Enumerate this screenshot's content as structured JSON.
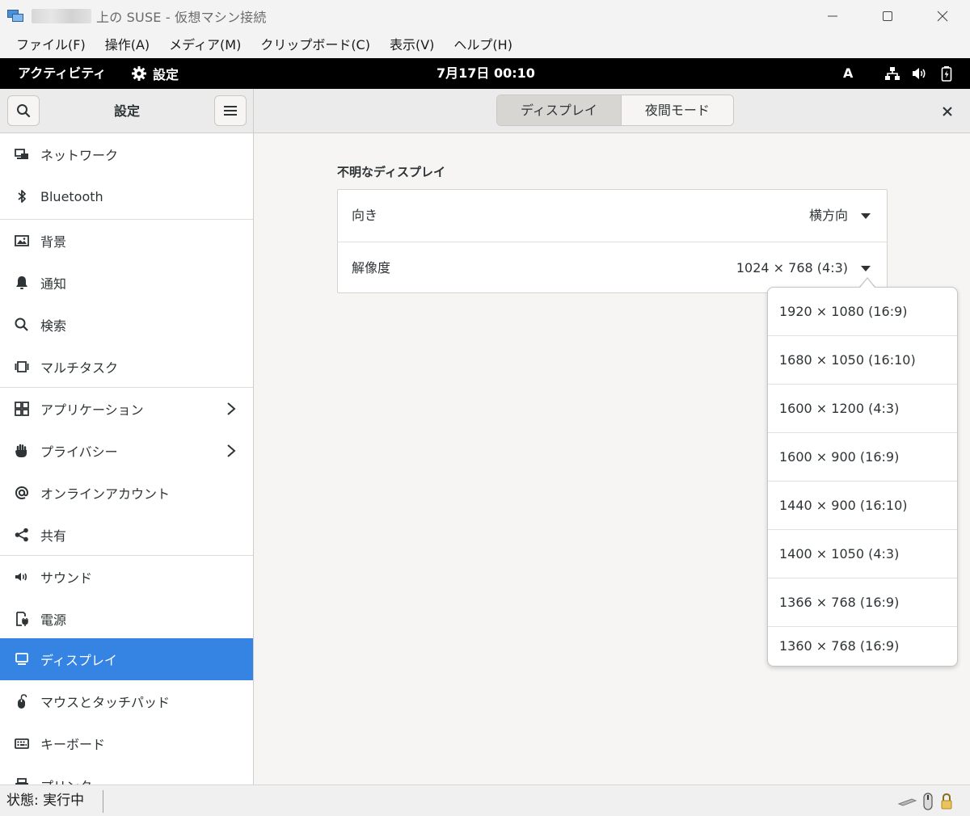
{
  "window": {
    "title": "上の SUSE  - 仮想マシン接続"
  },
  "menu": {
    "items": [
      "ファイル(F)",
      "操作(A)",
      "メディア(M)",
      "クリップボード(C)",
      "表示(V)",
      "ヘルプ(H)"
    ]
  },
  "topbar": {
    "activities": "アクティビティ",
    "app_name": "設定",
    "clock": "7月17日  00:10",
    "input_method": "A"
  },
  "header": {
    "sidebar_title": "設定",
    "tabs": [
      {
        "label": "ディスプレイ",
        "active": true
      },
      {
        "label": "夜間モード",
        "active": false
      }
    ]
  },
  "sidebar": {
    "items": [
      {
        "label": "ネットワーク",
        "icon": "network-icon",
        "chevron": false,
        "selected": false
      },
      {
        "label": "Bluetooth",
        "icon": "bluetooth-icon",
        "chevron": false,
        "selected": false
      },
      {
        "label": "背景",
        "icon": "background-icon",
        "chevron": false,
        "selected": false
      },
      {
        "label": "通知",
        "icon": "bell-icon",
        "chevron": false,
        "selected": false
      },
      {
        "label": "検索",
        "icon": "search-icon",
        "chevron": false,
        "selected": false
      },
      {
        "label": "マルチタスク",
        "icon": "multitasking-icon",
        "chevron": false,
        "selected": false
      },
      {
        "label": "アプリケーション",
        "icon": "apps-grid-icon",
        "chevron": true,
        "selected": false
      },
      {
        "label": "プライバシー",
        "icon": "hand-icon",
        "chevron": true,
        "selected": false
      },
      {
        "label": "オンラインアカウント",
        "icon": "at-sign-icon",
        "chevron": false,
        "selected": false
      },
      {
        "label": "共有",
        "icon": "share-icon",
        "chevron": false,
        "selected": false
      },
      {
        "label": "サウンド",
        "icon": "speaker-icon",
        "chevron": false,
        "selected": false
      },
      {
        "label": "電源",
        "icon": "power-icon",
        "chevron": false,
        "selected": false
      },
      {
        "label": "ディスプレイ",
        "icon": "display-icon",
        "chevron": false,
        "selected": true
      },
      {
        "label": "マウスとタッチパッド",
        "icon": "mouse-icon",
        "chevron": false,
        "selected": false
      },
      {
        "label": "キーボード",
        "icon": "keyboard-icon",
        "chevron": false,
        "selected": false
      },
      {
        "label": "プリンター",
        "icon": "printer-icon",
        "chevron": false,
        "selected": false
      }
    ]
  },
  "display": {
    "section_title": "不明なディスプレイ",
    "orientation_label": "向き",
    "orientation_value": "横方向",
    "resolution_label": "解像度",
    "resolution_value": "1024 × 768 (4:3)"
  },
  "resolution_options": [
    "1920 × 1080 (16:9)",
    "1680 × 1050 (16:10)",
    "1600 × 1200 (4:3)",
    "1600 × 900 (16:9)",
    "1440 × 900 (16:10)",
    "1400 × 1050 (4:3)",
    "1366 × 768 (16:9)",
    "1360 × 768 (16:9)"
  ],
  "statusbar": {
    "status": "状態: 実行中"
  },
  "colors": {
    "accent": "#3584e4",
    "topbar": "#000000",
    "headerbar": "#ebebeb"
  }
}
